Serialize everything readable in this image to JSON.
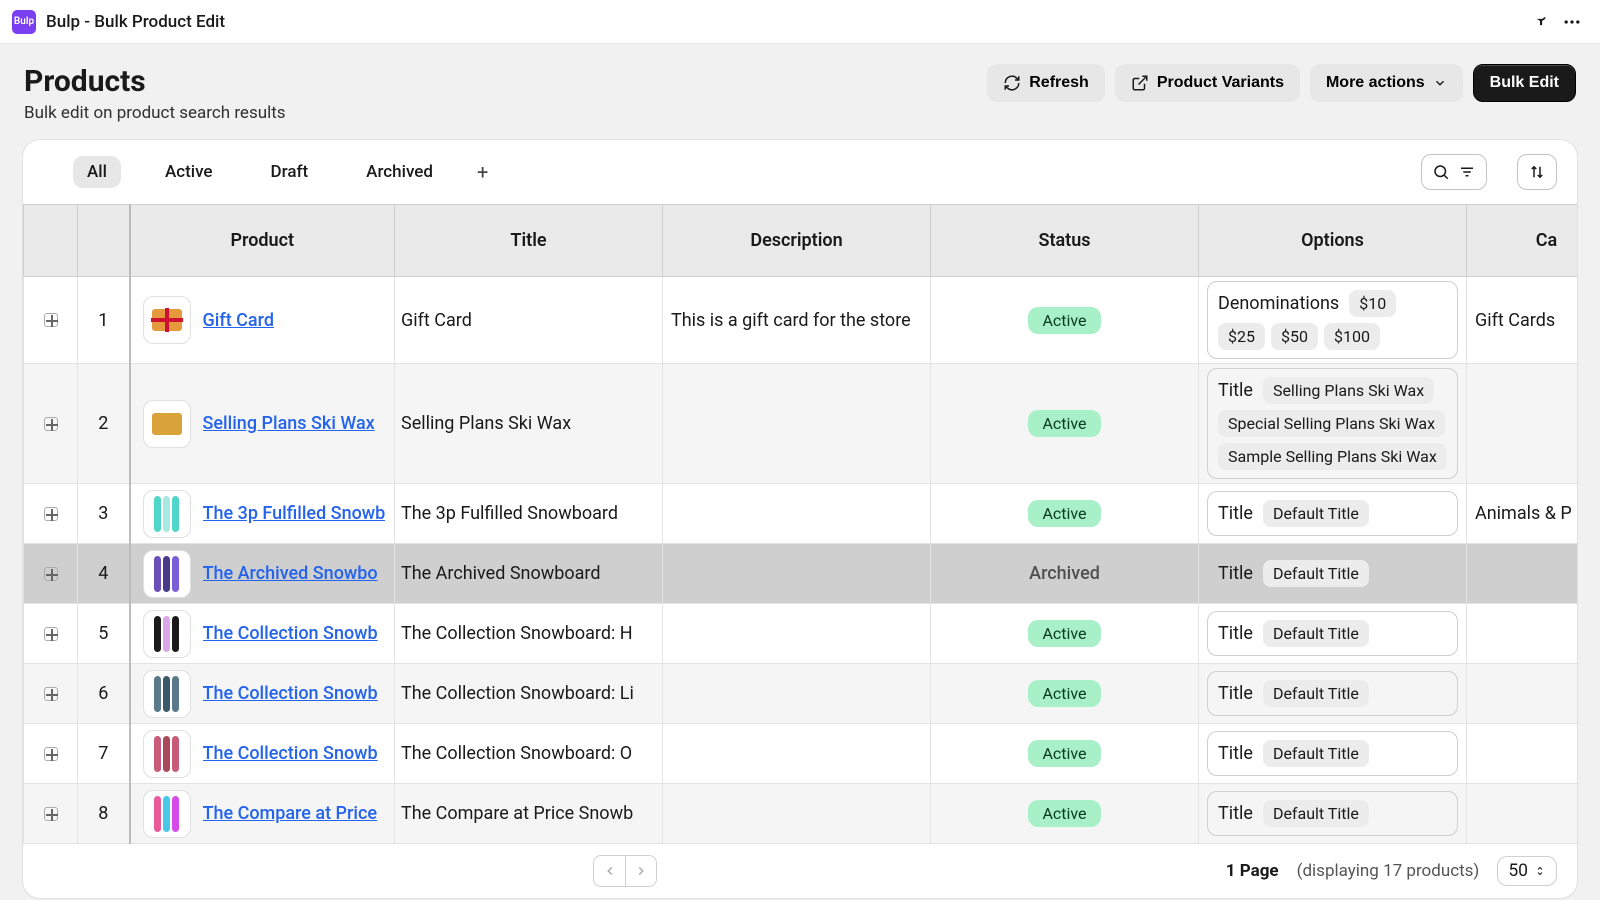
{
  "app": {
    "badge": "Bulp",
    "title": "Bulp - Bulk Product Edit"
  },
  "header": {
    "title": "Products",
    "subtitle": "Bulk edit on product search results",
    "refresh": "Refresh",
    "variants": "Product Variants",
    "more": "More actions",
    "bulk_edit": "Bulk Edit"
  },
  "tabs": {
    "all": "All",
    "active": "Active",
    "draft": "Draft",
    "archived": "Archived"
  },
  "columns": {
    "product": "Product",
    "title": "Title",
    "description": "Description",
    "status": "Status",
    "options": "Options",
    "category": "Ca"
  },
  "status_labels": {
    "active": "Active",
    "archived": "Archived"
  },
  "rows": [
    {
      "n": "1",
      "name": "Gift Card",
      "title": "Gift Card",
      "desc": "This is a gift card for the store",
      "status": "Active",
      "opt_name": "Denominations",
      "opts": [
        "$10",
        "$25",
        "$50",
        "$100"
      ],
      "cat": "Gift Cards",
      "zebra": false
    },
    {
      "n": "2",
      "name": "Selling Plans Ski Wax",
      "title": "Selling Plans Ski Wax",
      "desc": "",
      "status": "Active",
      "opt_name": "Title",
      "opts": [
        "Selling Plans Ski Wax",
        "Special Selling Plans Ski Wax",
        "Sample Selling Plans Ski Wax"
      ],
      "cat": "",
      "zebra": true
    },
    {
      "n": "3",
      "name": "The 3p Fulfilled Snowb",
      "title": "The 3p Fulfilled Snowboard",
      "desc": "",
      "status": "Active",
      "opt_name": "Title",
      "opts": [
        "Default Title"
      ],
      "cat": "Animals & P",
      "zebra": false
    },
    {
      "n": "4",
      "name": "The Archived Snowbo",
      "title": "The Archived Snowboard",
      "desc": "",
      "status": "Archived",
      "opt_name": "Title",
      "opts": [
        "Default Title"
      ],
      "cat": "",
      "zebra": false,
      "archived": true
    },
    {
      "n": "5",
      "name": "The Collection Snowb",
      "title": "The Collection Snowboard: H",
      "desc": "",
      "status": "Active",
      "opt_name": "Title",
      "opts": [
        "Default Title"
      ],
      "cat": "",
      "zebra": false
    },
    {
      "n": "6",
      "name": "The Collection Snowb",
      "title": "The Collection Snowboard: Li",
      "desc": "",
      "status": "Active",
      "opt_name": "Title",
      "opts": [
        "Default Title"
      ],
      "cat": "",
      "zebra": true
    },
    {
      "n": "7",
      "name": "The Collection Snowb",
      "title": "The Collection Snowboard: O",
      "desc": "",
      "status": "Active",
      "opt_name": "Title",
      "opts": [
        "Default Title"
      ],
      "cat": "",
      "zebra": false
    },
    {
      "n": "8",
      "name": "The Compare at Price",
      "title": "The Compare at Price Snowb",
      "desc": "",
      "status": "Active",
      "opt_name": "Title",
      "opts": [
        "Default Title"
      ],
      "cat": "",
      "zebra": true
    }
  ],
  "chart_data": {
    "type": "table",
    "title": "Products",
    "columns": [
      "#",
      "Product",
      "Title",
      "Description",
      "Status",
      "Options",
      "Category"
    ],
    "rows": [
      [
        "1",
        "Gift Card",
        "Gift Card",
        "This is a gift card for the store",
        "Active",
        "Denominations: $10,$25,$50,$100",
        "Gift Cards"
      ],
      [
        "2",
        "Selling Plans Ski Wax",
        "Selling Plans Ski Wax",
        "",
        "Active",
        "Title: Selling Plans Ski Wax, Special Selling Plans Ski Wax, Sample Selling Plans Ski Wax",
        ""
      ],
      [
        "3",
        "The 3p Fulfilled Snowboard",
        "The 3p Fulfilled Snowboard",
        "",
        "Active",
        "Title: Default Title",
        "Animals & P"
      ],
      [
        "4",
        "The Archived Snowboard",
        "The Archived Snowboard",
        "",
        "Archived",
        "Title: Default Title",
        ""
      ],
      [
        "5",
        "The Collection Snowboard: H",
        "The Collection Snowboard: H",
        "",
        "Active",
        "Title: Default Title",
        ""
      ],
      [
        "6",
        "The Collection Snowboard: Li",
        "The Collection Snowboard: Li",
        "",
        "Active",
        "Title: Default Title",
        ""
      ],
      [
        "7",
        "The Collection Snowboard: O",
        "The Collection Snowboard: O",
        "",
        "Active",
        "Title: Default Title",
        ""
      ],
      [
        "8",
        "The Compare at Price Snowboard",
        "The Compare at Price Snowb",
        "",
        "Active",
        "Title: Default Title",
        ""
      ]
    ]
  },
  "footer": {
    "page_label": "1 Page",
    "display": "(displaying 17 products)",
    "page_size": "50"
  }
}
